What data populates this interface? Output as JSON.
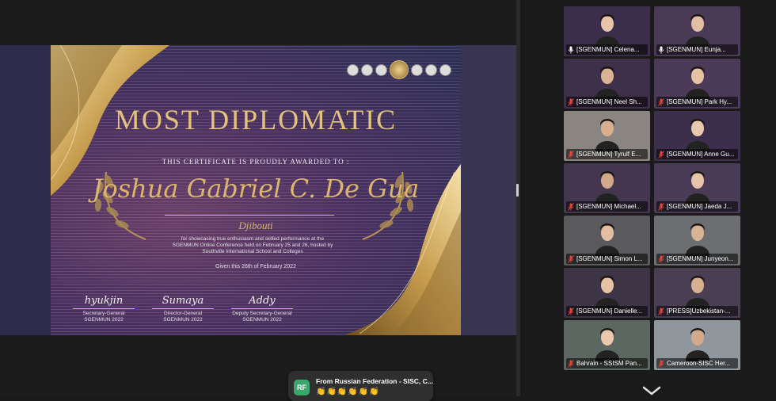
{
  "certificate": {
    "title": "MOST DIPLOMATIC",
    "subtitle": "THIS CERTIFICATE IS PROUDLY AWARDED TO :",
    "recipient": "Joshua Gabriel C. De Gua",
    "country": "Djibouti",
    "description": "for showcasing true enthusiasm and skilled performance at the SGENMUN Online Conference held on February 25 and 26, hosted by Southville International School and Colleges",
    "given": "Given this 26th of February 2022",
    "signatories": [
      {
        "signature": "hyukjin",
        "role": "Secretary-General",
        "org": "SGENMUN 2022"
      },
      {
        "signature": "Sumaya",
        "role": "Director-General",
        "org": "SGENMUN 2022"
      },
      {
        "signature": "Addy",
        "role": "Deputy Secretary-General",
        "org": "SGENMUN 2022"
      }
    ]
  },
  "participants": [
    {
      "name": "[SGENMUN] Celena...",
      "muted": false
    },
    {
      "name": "[SGENMUN] Eunja...",
      "muted": false
    },
    {
      "name": "[SGENMUN] Neel Sh...",
      "muted": true
    },
    {
      "name": "[SGENMUN] Park Hy...",
      "muted": true
    },
    {
      "name": "[SGENMUN] Tyrulf E...",
      "muted": true
    },
    {
      "name": "[SGENMUN] Anne Gu...",
      "muted": true
    },
    {
      "name": "[SGENMUN] Michael...",
      "muted": true
    },
    {
      "name": "[SGENMUN] Jaeda J...",
      "muted": true
    },
    {
      "name": "[SGENMUN] Simon L...",
      "muted": true
    },
    {
      "name": "[SGENMUN] Junyeon...",
      "muted": true
    },
    {
      "name": "[SGENMUN] Danielle...",
      "muted": true
    },
    {
      "name": "[PRESS]Uzbekistan-...",
      "muted": true
    },
    {
      "name": "Bahrain - SSISM Pan...",
      "muted": true
    },
    {
      "name": "Cameroon-SISC Her...",
      "muted": true
    }
  ],
  "chat": {
    "initials": "RF",
    "from": "From Russian Federation - SISC, C...",
    "message": "👏👏👏👏👏👏"
  },
  "colors": {
    "active_speaker": "#6ed46a",
    "muted_icon": "#e5473d",
    "gold": "#d9b56f",
    "chat_avatar": "#3aa76d"
  }
}
